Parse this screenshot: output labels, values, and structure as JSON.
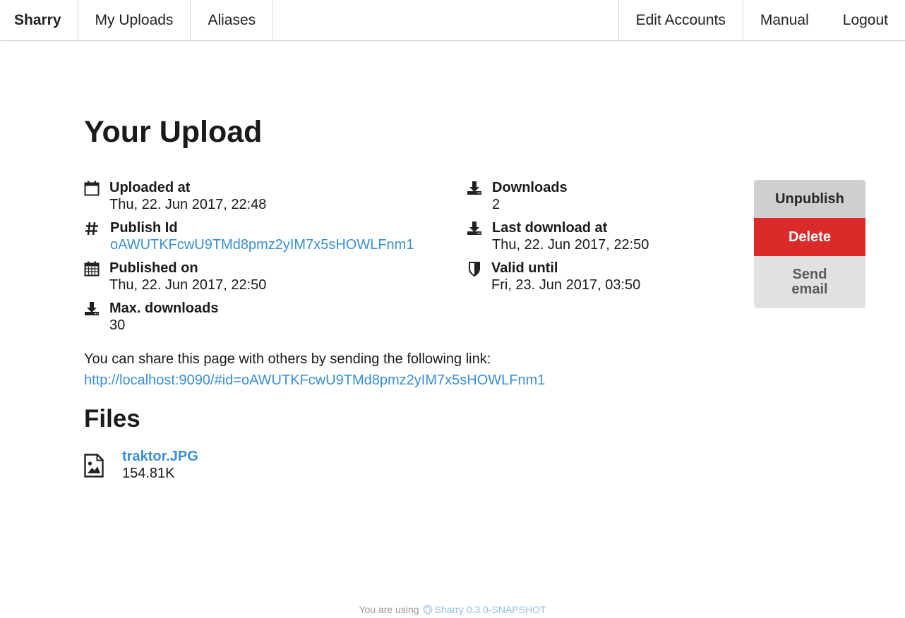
{
  "nav": {
    "brand": "Sharry",
    "left_items": [
      "My Uploads",
      "Aliases"
    ],
    "right_items": [
      "Edit Accounts",
      "Manual",
      "Logout"
    ]
  },
  "page": {
    "title": "Your Upload"
  },
  "details": {
    "uploaded_at": {
      "label": "Uploaded at",
      "value": "Thu, 22. Jun 2017, 22:48",
      "icon": "calendar-outline-icon"
    },
    "publish_id": {
      "label": "Publish Id",
      "value": "oAWUTKFcwU9TMd8pmz2yIM7x5sHOWLFnm1",
      "icon": "hash-icon"
    },
    "published_on": {
      "label": "Published on",
      "value": "Thu, 22. Jun 2017, 22:50",
      "icon": "calendar-icon"
    },
    "max_downloads": {
      "label": "Max. downloads",
      "value": "30",
      "icon": "download-icon"
    },
    "downloads": {
      "label": "Downloads",
      "value": "2",
      "icon": "download-icon"
    },
    "last_download_at": {
      "label": "Last download at",
      "value": "Thu, 22. Jun 2017, 22:50",
      "icon": "download-icon"
    },
    "valid_until": {
      "label": "Valid until",
      "value": "Fri, 23. Jun 2017, 03:50",
      "icon": "shield-icon"
    }
  },
  "actions": {
    "unpublish": "Unpublish",
    "delete": "Delete",
    "send_email": "Send email"
  },
  "share": {
    "text": "You can share this page with others by sending the following link:",
    "link": "http://localhost:9090/#id=oAWUTKFcwU9TMd8pmz2yIM7x5sHOWLFnm1"
  },
  "files": {
    "heading": "Files",
    "items": [
      {
        "name": "traktor.JPG",
        "size": "154.81K",
        "icon": "image-file-icon"
      }
    ]
  },
  "footer": {
    "prefix": "You are using",
    "version": "Sharry 0.3.0-SNAPSHOT",
    "icon": "github-icon"
  },
  "colors": {
    "link": "#3a8ed6",
    "delete_button": "#da2a2a",
    "unpublish_button": "#cfcfcf",
    "send_email_button": "#e0e1e2"
  }
}
